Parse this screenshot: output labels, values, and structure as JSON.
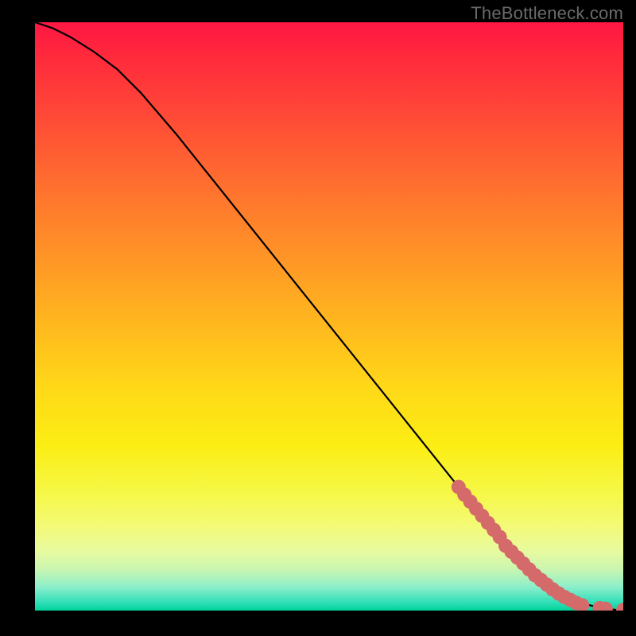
{
  "attribution": "TheBottleneck.com",
  "chart_data": {
    "type": "line",
    "title": "",
    "xlabel": "",
    "ylabel": "",
    "xlim": [
      0,
      100
    ],
    "ylim": [
      0,
      100
    ],
    "grid": false,
    "legend": false,
    "series": [
      {
        "name": "curve",
        "style": "line",
        "x": [
          0,
          3,
          6,
          10,
          14,
          18,
          24,
          30,
          40,
          50,
          60,
          70,
          78,
          85,
          90,
          93,
          96,
          98,
          100
        ],
        "y": [
          100,
          99,
          97.5,
          95,
          92,
          88,
          81,
          73.5,
          61,
          48.5,
          36,
          23.5,
          13.5,
          6,
          2.5,
          1.2,
          0.5,
          0.2,
          0
        ]
      },
      {
        "name": "markers",
        "style": "scatter",
        "color": "#d46a6a",
        "x": [
          72,
          73,
          74,
          75,
          76,
          77,
          78,
          79,
          80,
          81,
          82,
          83,
          84,
          85,
          86,
          87,
          88,
          89,
          90,
          91,
          92,
          93,
          96,
          97,
          100
        ],
        "y": [
          21,
          19.7,
          18.5,
          17.3,
          16.1,
          14.9,
          13.7,
          12.5,
          11,
          10,
          9,
          8,
          7,
          6,
          5.2,
          4.4,
          3.6,
          2.9,
          2.3,
          1.8,
          1.3,
          0.9,
          0.4,
          0.3,
          0.1
        ]
      }
    ]
  }
}
